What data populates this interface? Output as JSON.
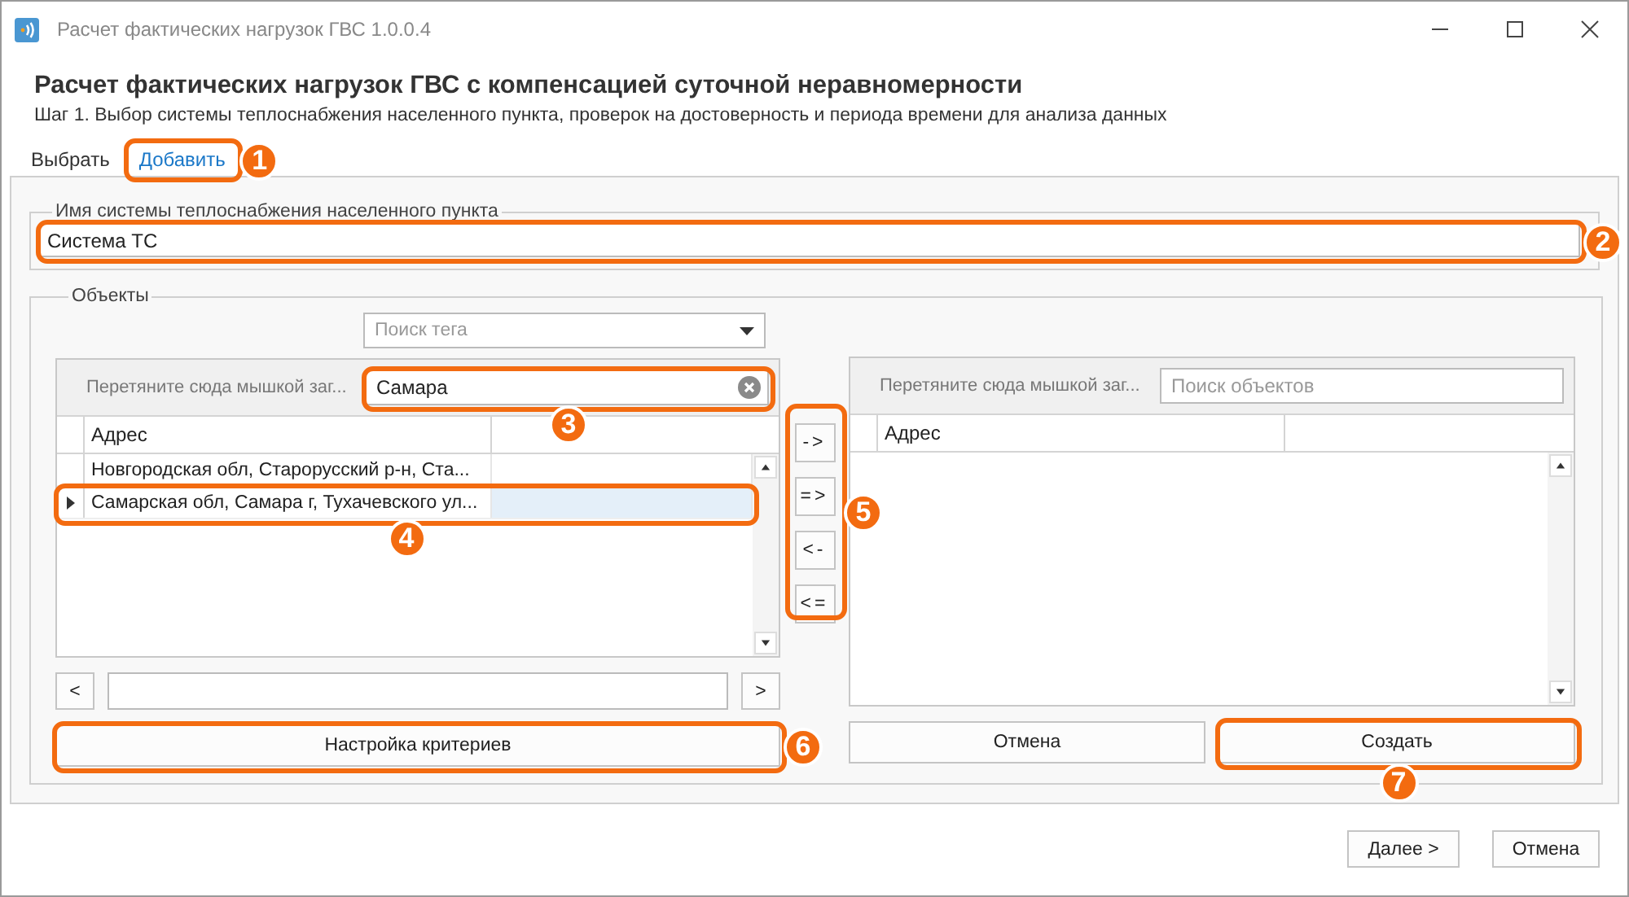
{
  "window": {
    "title": "Расчет фактических нагрузок ГВС 1.0.0.4"
  },
  "header": {
    "title": "Расчет фактических нагрузок ГВС с компенсацией суточной неравномерности",
    "subtitle": "Шаг 1. Выбор системы теплоснабжения населенного пункта, проверок на достоверность и периода времени для анализа данных"
  },
  "tabs": [
    {
      "label": "Выбрать",
      "selected": false
    },
    {
      "label": "Добавить",
      "selected": true
    }
  ],
  "system_group": {
    "legend": "Имя системы теплоснабжения населенного пункта",
    "name_field": {
      "value": "Система ТС"
    }
  },
  "objects_group": {
    "legend": "Объекты",
    "tag_search": {
      "placeholder": "Поиск тега"
    },
    "source_grid": {
      "group_panel": "Перетяните сюда мышкой заг...",
      "search": {
        "value": "Самара"
      },
      "columns": [
        "Адрес"
      ],
      "rows": [
        {
          "address": "Новгородская обл, Старорусский р-н, Ста...",
          "selected": false
        },
        {
          "address": "Самарская обл, Самара г, Тухачевского ул...",
          "selected": true
        }
      ]
    },
    "pager": {
      "prev": "<",
      "next": ">"
    },
    "criteria_button": "Настройка критериев",
    "transfer_buttons": [
      "->",
      "=>",
      "<-",
      "<="
    ],
    "target_grid": {
      "group_panel": "Перетяните сюда мышкой заг...",
      "search": {
        "placeholder": "Поиск объектов"
      },
      "columns": [
        "Адрес"
      ]
    },
    "cancel_button": "Отмена",
    "create_button": "Создать"
  },
  "footer": {
    "buttons": [
      "Далее >",
      "Отмена"
    ]
  },
  "callouts": [
    {
      "number": "1"
    },
    {
      "number": "2"
    },
    {
      "number": "3"
    },
    {
      "number": "4"
    },
    {
      "number": "5"
    },
    {
      "number": "6"
    },
    {
      "number": "7"
    }
  ]
}
